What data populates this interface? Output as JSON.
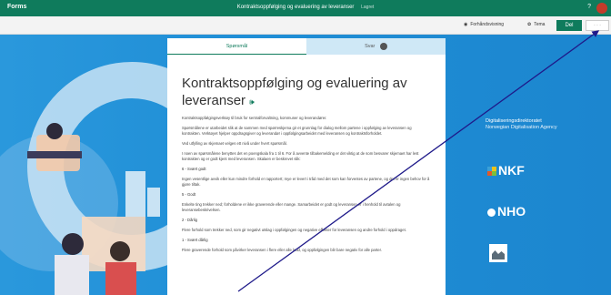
{
  "titlebar": {
    "app_name": "Forms",
    "title": "Kontraktsoppfølging og evaluering av leveranser",
    "saved": "Lagret",
    "help": "?"
  },
  "toolbar": {
    "preview": "Forhåndsvisning",
    "theme": "Tema",
    "share": "Del",
    "more": "· · ·",
    "icons": {
      "preview": "eye-icon",
      "theme": "palette-icon"
    }
  },
  "tabs": [
    {
      "label": "Spørsmål"
    },
    {
      "label": "Svar",
      "count": "0"
    }
  ],
  "form": {
    "title": "Kontraktsoppfølging og evaluering av leveranser",
    "paragraphs": [
      {
        "text": "Kontraktsoppfølgingsverktøy til bruk for sentralforvaltning, kommuner og leverandører.",
        "opt": false
      },
      {
        "text": "Spørsmålene er utarbeidet slik at de sammen med spørreskjema gir et grunnlag for dialog mellom partene i oppfølging av leveransen og kontrakten. Verktøyet hjelper oppdragsgiver og leverandør i oppfølgingsarbeidet med leveransen og kontraktsforholdet.",
        "opt": false
      },
      {
        "text": "Ved utfylling av skjemaet velges ett nivå under hvert spørsmål.",
        "opt": false
      },
      {
        "text": "I noen av spørsmålene benyttes det en poengskala fra 1 til 6. For å avvente tilbakemelding er det viktig at de som besvarer skjemaet har lest kontrakten og er godt kjent med leveransen. Skalaen er beskrevet slik:",
        "opt": false
      },
      {
        "text": "6 - Svært godt",
        "opt": true
      },
      {
        "text": "Ingen vesentlige avvik eller kun mindre forhold er rapportert; mye er levert i tråd med det som kan forventes av partene, og det er ingen behov for å gjøre tiltak.",
        "opt": false
      },
      {
        "text": "5 - Godt",
        "opt": true
      },
      {
        "text": "Enkelte ting trekker ned; forholdene er ikke graverende eller mange. Samarbeidet er godt og leveransen er i henhold til avtalen og leveransebeskrivelsen.",
        "opt": false
      },
      {
        "text": "2 - Dårlig",
        "opt": true
      },
      {
        "text": "Flere forhold som trekker ned, som gir negativt utslag i oppfølgingen og negative effekter for leveransen og andre forhold i oppdraget.",
        "opt": false
      },
      {
        "text": "1 - Svært dårlig",
        "opt": true
      },
      {
        "text": "Flere graverende forhold som påvirker leveransen i flere eller alle ledd, og oppfølgingen blir bare negativ for alle parter.",
        "opt": false
      }
    ]
  },
  "logos": {
    "digdir_no": "Digitaliseringsdirektoratet",
    "digdir_en": "Norwegian Digitalisation Agency",
    "nkf": "NKF",
    "nho": "NHO"
  },
  "annotation": {
    "color": "#1f1a8a"
  }
}
